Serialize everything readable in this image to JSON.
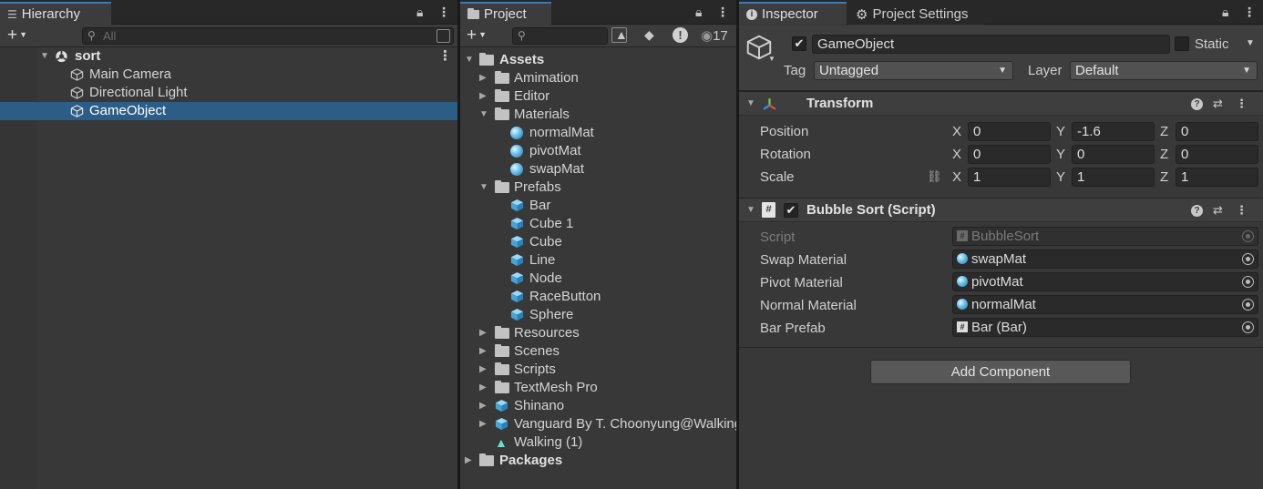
{
  "hierarchy": {
    "tab_label": "Hierarchy",
    "search_placeholder": "All",
    "add_label": "+",
    "scene": "sort",
    "items": [
      {
        "label": "Main Camera"
      },
      {
        "label": "Directional Light"
      },
      {
        "label": "GameObject"
      }
    ]
  },
  "project": {
    "tab_label": "Project",
    "add_label": "+",
    "hidden_count": "17",
    "tree": {
      "assets_label": "Assets",
      "packages_label": "Packages",
      "items": [
        {
          "label": "Amimation",
          "type": "folder",
          "depth": 1,
          "expanded": false
        },
        {
          "label": "Editor",
          "type": "folder",
          "depth": 1,
          "expanded": false
        },
        {
          "label": "Materials",
          "type": "folder",
          "depth": 1,
          "expanded": true
        },
        {
          "label": "normalMat",
          "type": "material",
          "depth": 2
        },
        {
          "label": "pivotMat",
          "type": "material",
          "depth": 2
        },
        {
          "label": "swapMat",
          "type": "material",
          "depth": 2
        },
        {
          "label": "Prefabs",
          "type": "folder",
          "depth": 1,
          "expanded": true
        },
        {
          "label": "Bar",
          "type": "prefab",
          "depth": 2
        },
        {
          "label": "Cube 1",
          "type": "prefab",
          "depth": 2
        },
        {
          "label": "Cube",
          "type": "prefab",
          "depth": 2
        },
        {
          "label": "Line",
          "type": "prefab",
          "depth": 2
        },
        {
          "label": "Node",
          "type": "prefab",
          "depth": 2
        },
        {
          "label": "RaceButton",
          "type": "prefab",
          "depth": 2
        },
        {
          "label": "Sphere",
          "type": "prefab",
          "depth": 2
        },
        {
          "label": "Resources",
          "type": "folder",
          "depth": 1,
          "expanded": false
        },
        {
          "label": "Scenes",
          "type": "folder",
          "depth": 1,
          "expanded": false
        },
        {
          "label": "Scripts",
          "type": "folder",
          "depth": 1,
          "expanded": false
        },
        {
          "label": "TextMesh Pro",
          "type": "folder",
          "depth": 1,
          "expanded": false
        },
        {
          "label": "Shinano",
          "type": "model",
          "depth": 1,
          "expanded": false
        },
        {
          "label": "Vanguard By T. Choonyung@Walking",
          "type": "model",
          "depth": 1,
          "expanded": false
        },
        {
          "label": "Walking (1)",
          "type": "anim",
          "depth": 1
        }
      ]
    }
  },
  "inspector": {
    "tab_label": "Inspector",
    "settings_tab_label": "Project Settings",
    "object_name": "GameObject",
    "static_label": "Static",
    "tag_label": "Tag",
    "tag_value": "Untagged",
    "layer_label": "Layer",
    "layer_value": "Default",
    "transform": {
      "title": "Transform",
      "position_label": "Position",
      "rotation_label": "Rotation",
      "scale_label": "Scale",
      "axis_x": "X",
      "axis_y": "Y",
      "axis_z": "Z",
      "position": {
        "x": "0",
        "y": "-1.6",
        "z": "0"
      },
      "rotation": {
        "x": "0",
        "y": "0",
        "z": "0"
      },
      "scale": {
        "x": "1",
        "y": "1",
        "z": "1"
      }
    },
    "script_component": {
      "title": "Bubble Sort (Script)",
      "script_label": "Script",
      "script_value": "BubbleSort",
      "swap_label": "Swap Material",
      "swap_value": "swapMat",
      "pivot_label": "Pivot Material",
      "pivot_value": "pivotMat",
      "normal_label": "Normal Material",
      "normal_value": "normalMat",
      "bar_label": "Bar Prefab",
      "bar_value": "Bar (Bar)"
    },
    "add_component_label": "Add Component"
  }
}
